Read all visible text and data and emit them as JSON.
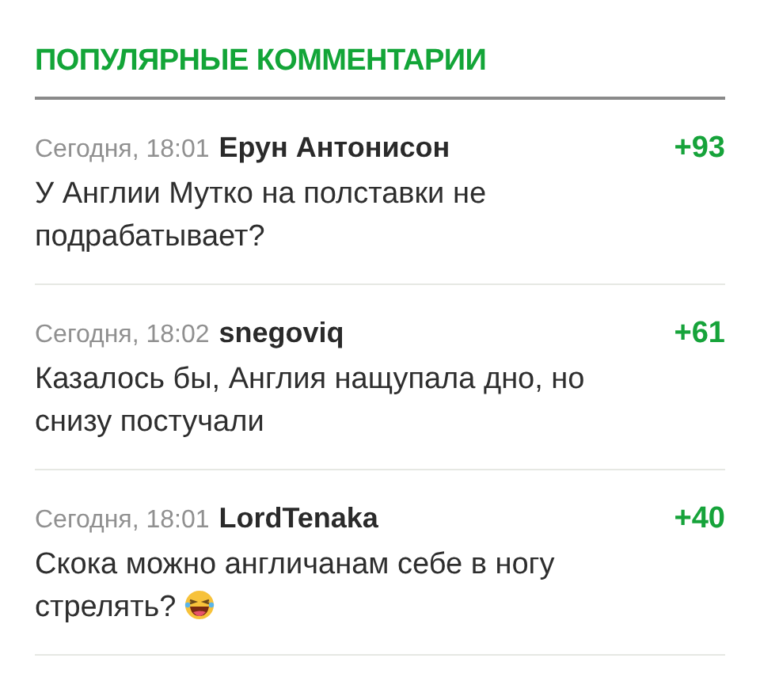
{
  "title": "ПОПУЛЯРНЫЕ КОММЕНТАРИИ",
  "comments": [
    {
      "time": "Сегодня, 18:01",
      "author": "Ерун Антонисон",
      "score": "+93",
      "text": "У Англии Мутко на полставки не подрабатывает?",
      "has_emoji": false
    },
    {
      "time": "Сегодня, 18:02",
      "author": "snegoviq",
      "score": "+61",
      "text": "Казалось бы, Англия нащупала дно, но снизу постучали",
      "has_emoji": false
    },
    {
      "time": "Сегодня, 18:01",
      "author": "LordTenaka",
      "score": "+40",
      "text": "Скока можно англичанам себе в ногу стрелять?",
      "has_emoji": true
    }
  ]
}
